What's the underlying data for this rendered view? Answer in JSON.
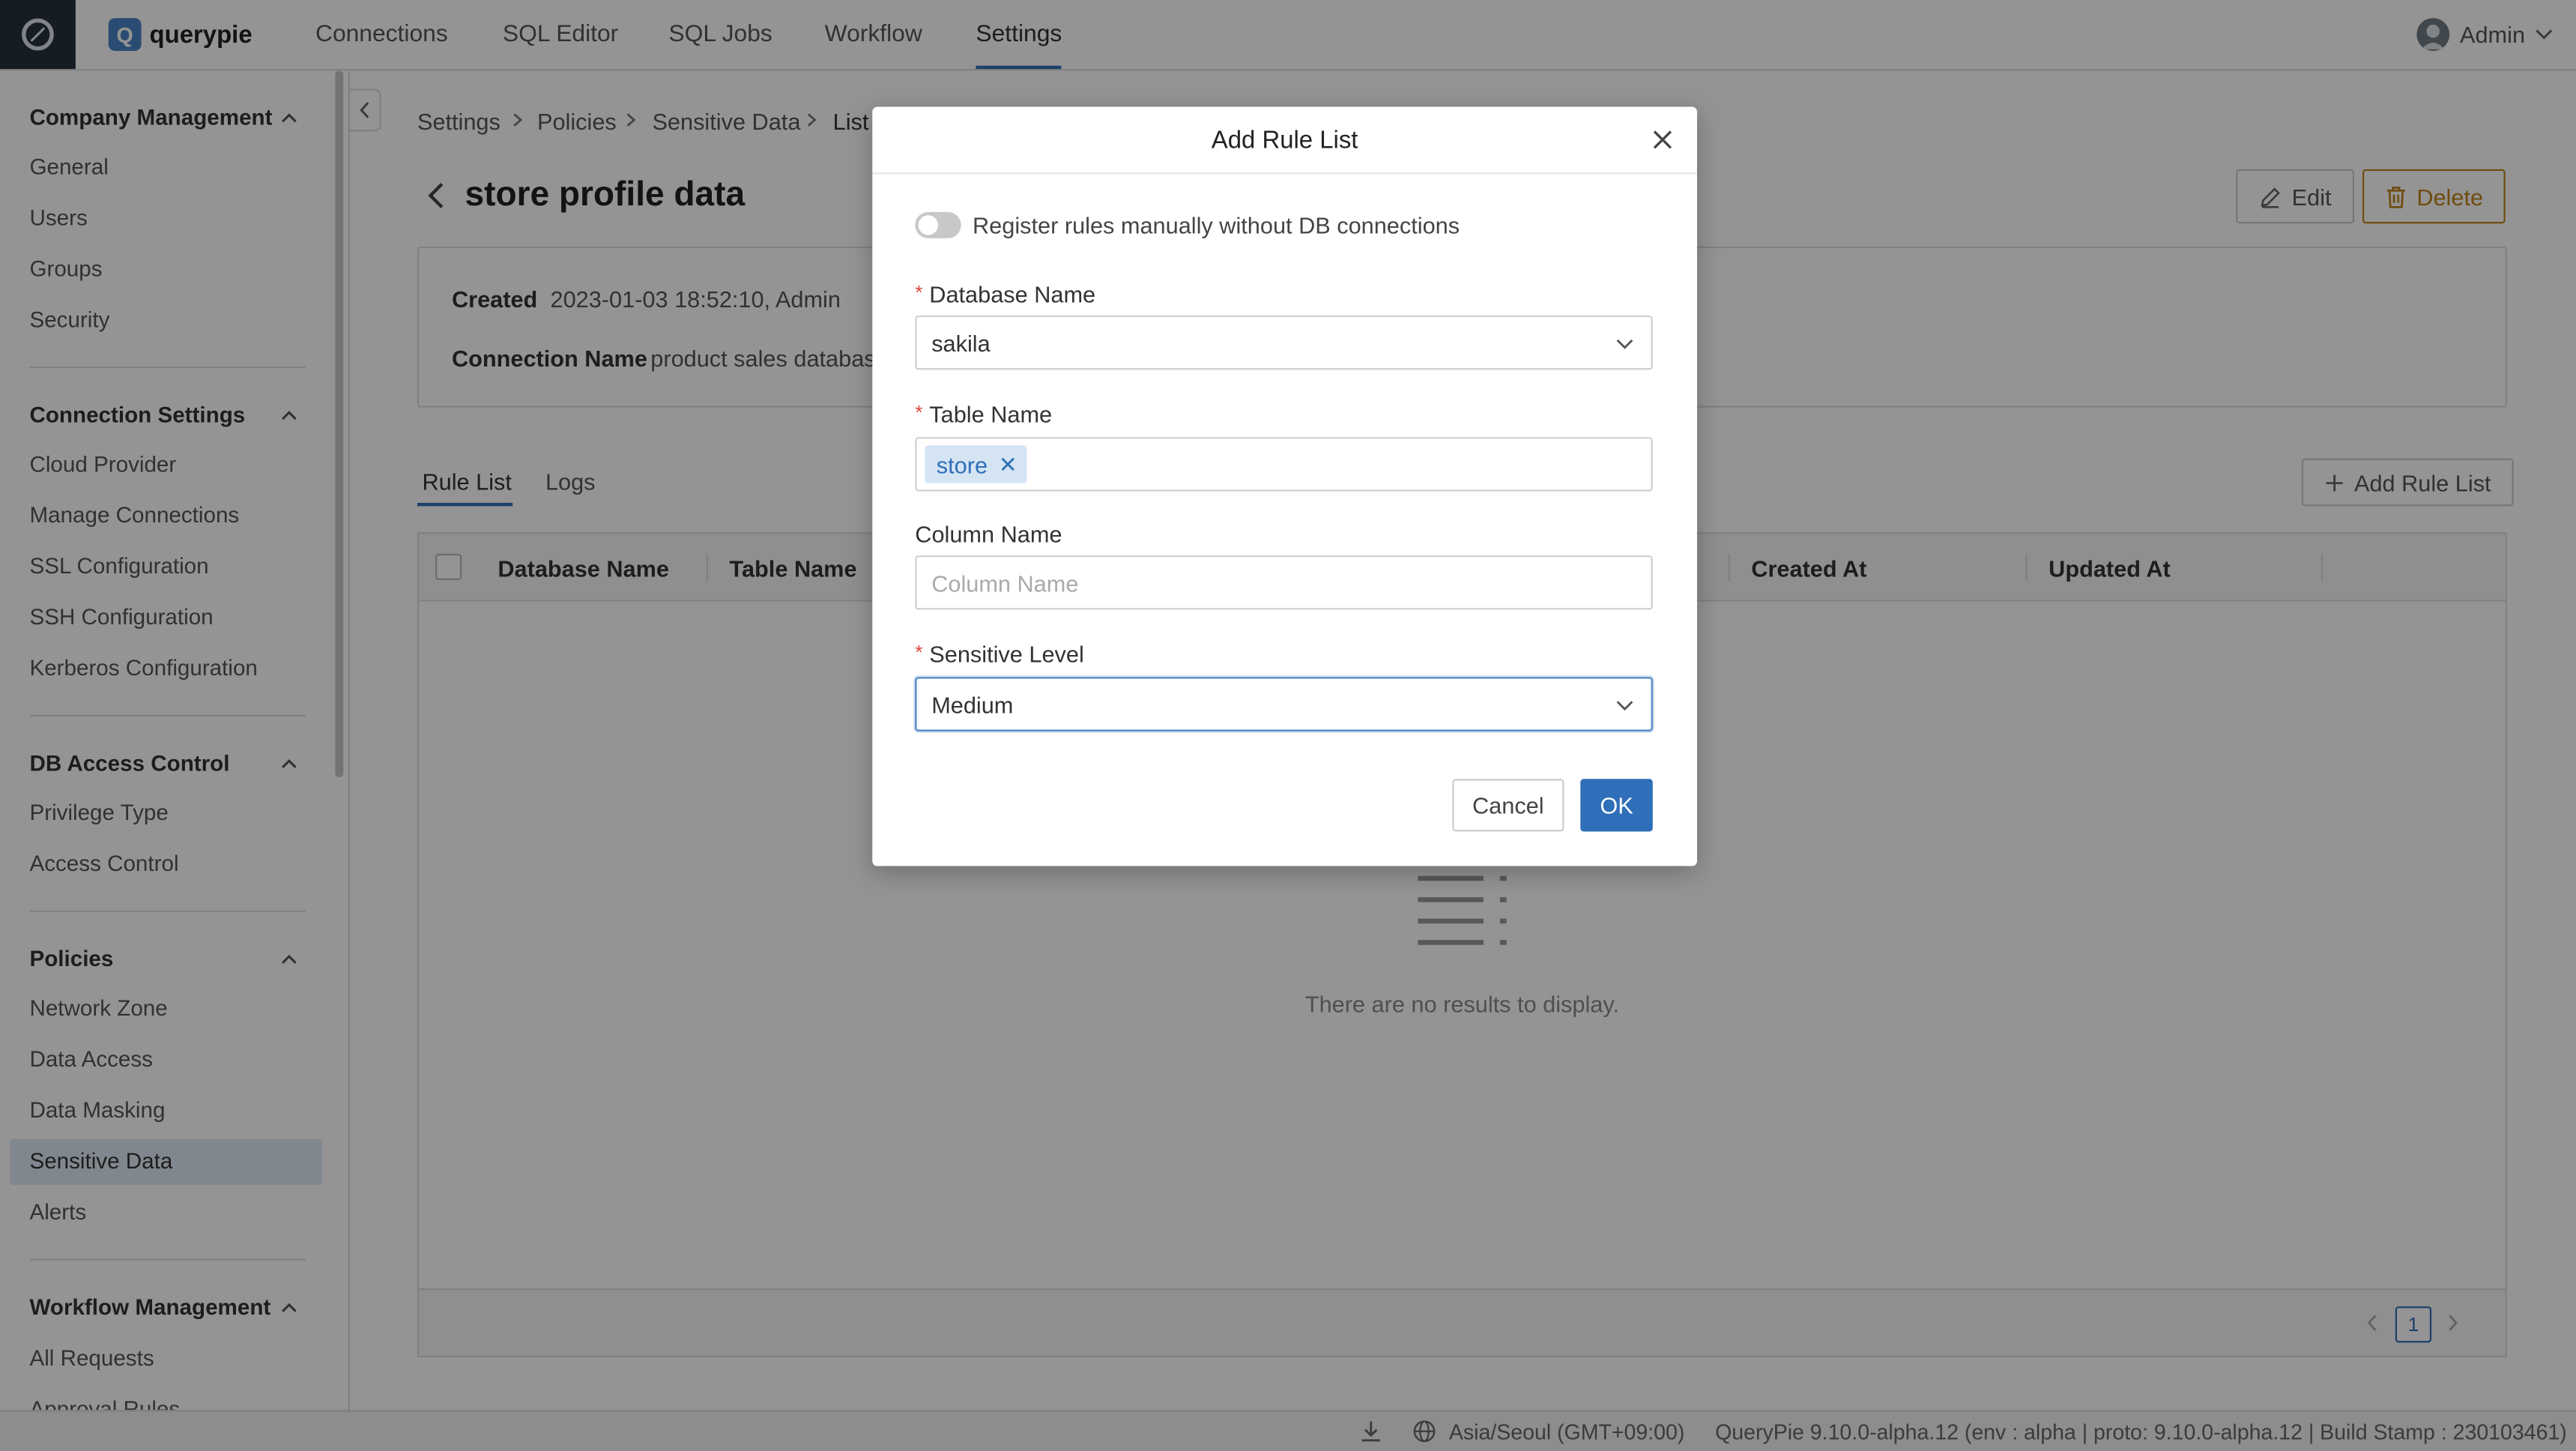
{
  "app": {
    "brand": "querypie",
    "brand_letter": "Q"
  },
  "nav": [
    "Connections",
    "SQL Editor",
    "SQL Jobs",
    "Workflow",
    "Settings"
  ],
  "user": {
    "name": "Admin"
  },
  "sidebar": {
    "sections": [
      {
        "title": "Company Management",
        "items": [
          "General",
          "Users",
          "Groups",
          "Security"
        ]
      },
      {
        "title": "Connection Settings",
        "items": [
          "Cloud Provider",
          "Manage Connections",
          "SSL Configuration",
          "SSH Configuration",
          "Kerberos Configuration"
        ]
      },
      {
        "title": "DB Access Control",
        "items": [
          "Privilege Type",
          "Access Control"
        ]
      },
      {
        "title": "Policies",
        "items": [
          "Network Zone",
          "Data Access",
          "Data Masking",
          "Sensitive Data",
          "Alerts"
        ]
      },
      {
        "title": "Workflow Management",
        "items": [
          "All Requests",
          "Approval Rules"
        ]
      }
    ],
    "active_item": "Sensitive Data"
  },
  "breadcrumb": [
    "Settings",
    "Policies",
    "Sensitive Data",
    "List"
  ],
  "page": {
    "title": "store profile data",
    "edit_label": "Edit",
    "delete_label": "Delete",
    "created_label": "Created",
    "created_value": "2023-01-03 18:52:10, Admin",
    "connection_label": "Connection Name",
    "connection_value": "product sales database"
  },
  "tabs": [
    "Rule List",
    "Logs"
  ],
  "add_rule_label": "Add Rule List",
  "table": {
    "columns": [
      "Database Name",
      "Table Name",
      "Created At",
      "Updated At"
    ],
    "empty_text": "There are no results to display.",
    "page": "1"
  },
  "statusbar": {
    "timezone": "Asia/Seoul (GMT+09:00)",
    "version": "QueryPie 9.10.0-alpha.12 (env : alpha | proto: 9.10.0-alpha.12 | Build Stamp : 230103461)"
  },
  "modal": {
    "title": "Add Rule List",
    "toggle_label": "Register rules manually without DB connections",
    "toggle_on": false,
    "database_label": "Database Name",
    "database_value": "sakila",
    "table_label": "Table Name",
    "table_chip": "store",
    "column_label": "Column Name",
    "column_placeholder": "Column Name",
    "level_label": "Sensitive Level",
    "level_value": "Medium",
    "cancel_label": "Cancel",
    "ok_label": "OK"
  },
  "colors": {
    "accent": "#2f6eb8",
    "delete": "#c0841a",
    "required": "#e0483d"
  }
}
